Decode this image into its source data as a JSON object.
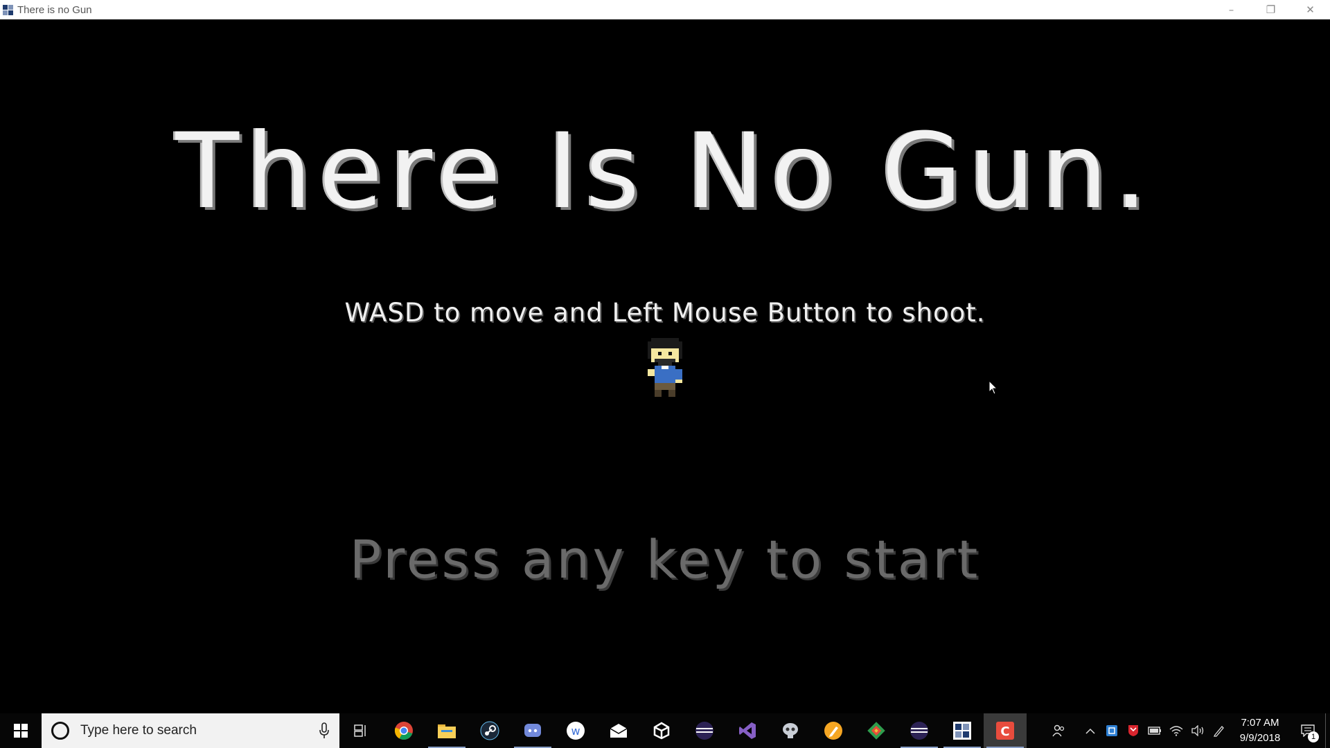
{
  "window": {
    "title": "There is no Gun",
    "icon": "game-window-icon",
    "controls": {
      "minimize": "–",
      "restore": "❐",
      "close": "✕"
    }
  },
  "game": {
    "title": "There Is No Gun.",
    "instructions": "WASD to move and Left Mouse Button to shoot.",
    "prompt": "Press any key to start",
    "sprite": "player-character-sprite",
    "colors": {
      "background": "#000000",
      "title": "#f2f2f2",
      "prompt": "#6a6a6a"
    }
  },
  "taskbar": {
    "search_placeholder": "Type here to search",
    "apps": [
      {
        "name": "chrome-icon",
        "running": false
      },
      {
        "name": "file-explorer-icon",
        "running": true
      },
      {
        "name": "steam-icon",
        "running": false
      },
      {
        "name": "discord-icon",
        "running": true
      },
      {
        "name": "w-app-icon",
        "running": false
      },
      {
        "name": "mail-icon",
        "running": false
      },
      {
        "name": "unity-icon",
        "running": false
      },
      {
        "name": "eclipse-icon",
        "running": false
      },
      {
        "name": "visual-studio-icon",
        "running": false
      },
      {
        "name": "skull-app-icon",
        "running": false
      },
      {
        "name": "pencil-app-icon",
        "running": false
      },
      {
        "name": "git-icon",
        "running": false
      },
      {
        "name": "eclipse-icon-2",
        "running": true
      },
      {
        "name": "game-window-icon",
        "running": true
      },
      {
        "name": "c-app-icon",
        "running": true,
        "active": true
      }
    ],
    "tray": {
      "people_icon": "people-icon",
      "chevron": "chevron-up-icon",
      "icons": [
        "defender-icon",
        "mcafee-icon",
        "battery-icon",
        "wifi-icon",
        "volume-icon",
        "pen-icon"
      ],
      "time": "7:07 AM",
      "date": "9/9/2018",
      "notification_count": "1"
    }
  }
}
